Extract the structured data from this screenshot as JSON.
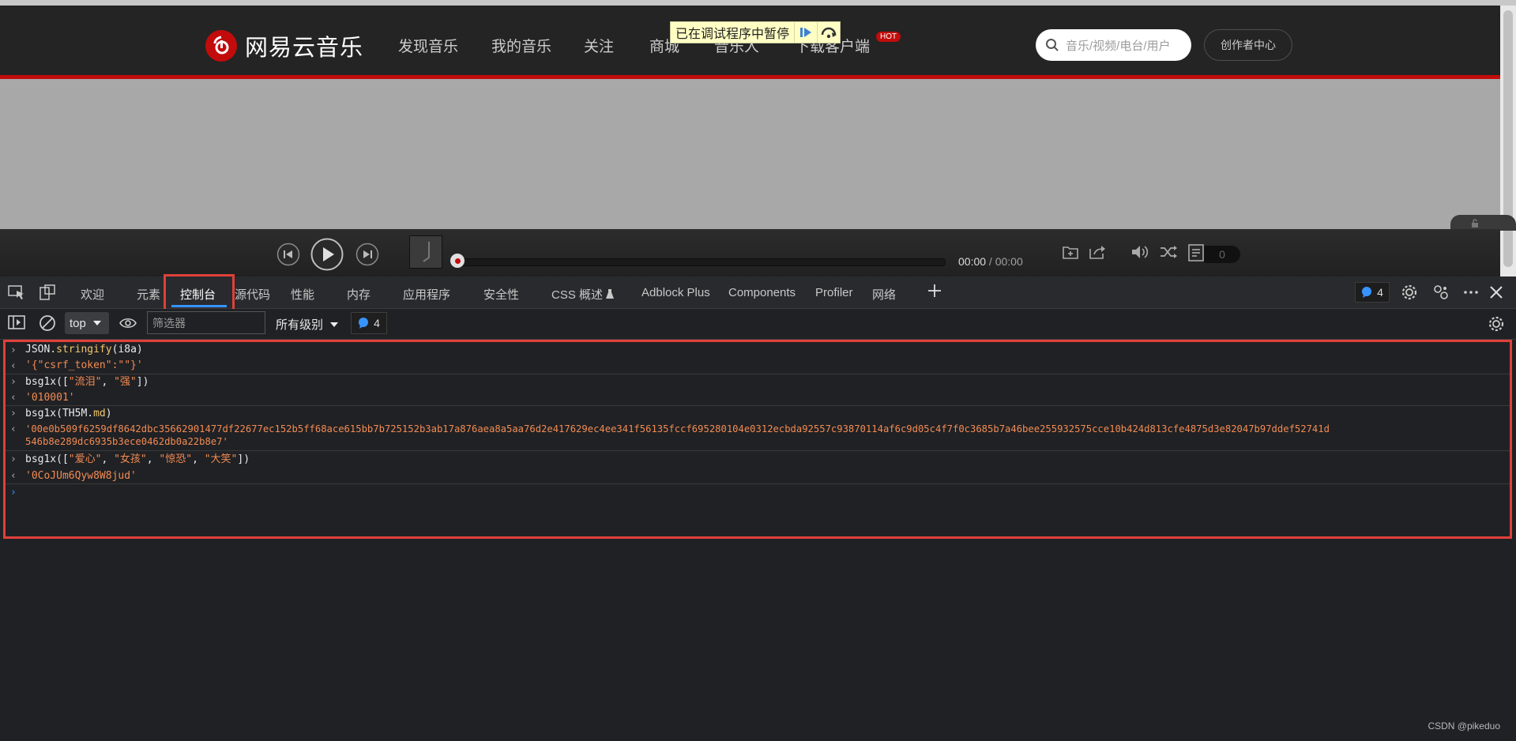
{
  "site": {
    "logo_text": "网易云音乐",
    "nav": [
      "发现音乐",
      "我的音乐",
      "关注",
      "商城",
      "音乐人",
      "下载客户端"
    ],
    "hot_badge": "HOT",
    "search_placeholder": "音乐/视频/电台/用户",
    "creator_button": "创作者中心",
    "debug_banner": "已在调试程序中暂停"
  },
  "player": {
    "current_time": "00:00",
    "separator": " / ",
    "total_time": "00:00",
    "playlist_count": "0"
  },
  "devtools": {
    "tabs": [
      "欢迎",
      "元素",
      "控制台",
      "源代码",
      "性能",
      "内存",
      "应用程序",
      "安全性",
      "CSS 概述",
      "Adblock Plus",
      "Components",
      "Profiler",
      "网络"
    ],
    "active_tab": "控制台",
    "message_count": "4"
  },
  "console_toolbar": {
    "context": "top",
    "filter_placeholder": "筛选器",
    "levels": "所有级别",
    "message_count": "4"
  },
  "console": {
    "entries": [
      {
        "type": "input",
        "pre": "JSON.",
        "prop": "stringify",
        "post": "(i8a)"
      },
      {
        "type": "output",
        "text": "'{\"csrf_token\":\"\"}'"
      },
      {
        "type": "input",
        "pre": "bsg1x([",
        "s1": "\"流泪\"",
        "mid": ", ",
        "s2": "\"强\"",
        "post": "])"
      },
      {
        "type": "output",
        "text": "'010001'"
      },
      {
        "type": "input",
        "pre": "bsg1x(TH5M.",
        "prop": "md",
        "post": ")"
      },
      {
        "type": "output",
        "line1": "'00e0b509f6259df8642dbc35662901477df22677ec152b5ff68ace615bb7b725152b3ab17a876aea8a5aa76d2e417629ec4ee341f56135fccf695280104e0312ecbda92557c93870114af6c9d05c4f7f0c3685b7a46bee255932575cce10b424d813cfe4875d3e82047b97ddef52741d",
        "line2": "546b8e289dc6935b3ece0462db0a22b8e7'"
      },
      {
        "type": "input",
        "pre": "bsg1x([",
        "s1": "\"爱心\"",
        "sep1": ", ",
        "s2": "\"女孩\"",
        "sep2": ", ",
        "s3": "\"惊恐\"",
        "sep3": ", ",
        "s4": "\"大笑\"",
        "post": "])"
      },
      {
        "type": "output",
        "text": "'0CoJUm6Qyw8W8jud'"
      }
    ]
  },
  "watermark": "CSDN @pikeduo"
}
